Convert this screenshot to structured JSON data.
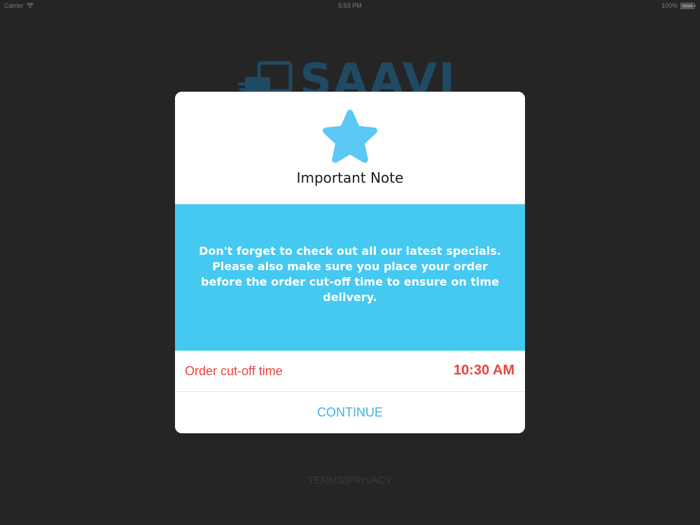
{
  "status_bar": {
    "carrier": "Carrier",
    "time": "5:53 PM",
    "battery": "100%",
    "icons": [
      "wifi-icon",
      "battery-icon"
    ]
  },
  "background": {
    "logo_text": "SAAVI",
    "footer_links": "TERMS|PRIVACY"
  },
  "modal": {
    "icon": "star-icon",
    "title": "Important Note",
    "message": "Don't forget to check out all our latest specials. Please also make sure you place your order before the order cut-off time to ensure on time delivery.",
    "cutoff_label": "Order cut-off time",
    "cutoff_value": "10:30 AM",
    "continue_label": "CONTINUE"
  },
  "colors": {
    "accent_blue": "#45c9f1",
    "star_blue": "#5bc8f5",
    "alert_red": "#e8453c",
    "button_blue": "#3fb3de"
  }
}
